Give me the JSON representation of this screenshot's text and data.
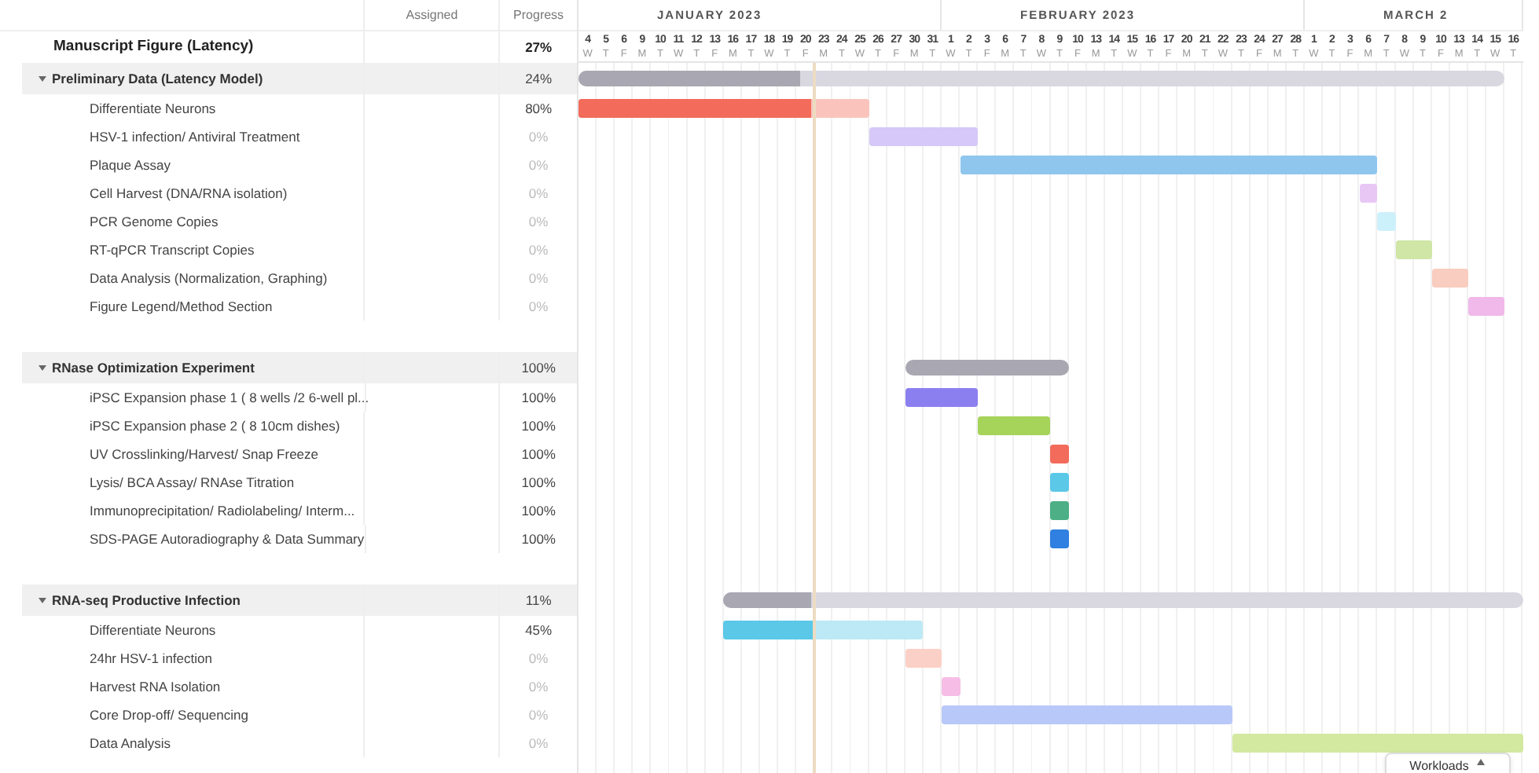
{
  "columns": {
    "assigned": "Assigned",
    "progress": "Progress"
  },
  "timeline": {
    "months": [
      {
        "label": "JANUARY 2023",
        "days": [
          {
            "num": "4",
            "dow": "W"
          },
          {
            "num": "5",
            "dow": "T"
          },
          {
            "num": "6",
            "dow": "F"
          },
          {
            "num": "9",
            "dow": "M"
          },
          {
            "num": "10",
            "dow": "T"
          },
          {
            "num": "11",
            "dow": "W"
          },
          {
            "num": "12",
            "dow": "T"
          },
          {
            "num": "13",
            "dow": "F"
          },
          {
            "num": "16",
            "dow": "M"
          },
          {
            "num": "17",
            "dow": "T"
          },
          {
            "num": "18",
            "dow": "W"
          },
          {
            "num": "19",
            "dow": "T"
          },
          {
            "num": "20",
            "dow": "F"
          },
          {
            "num": "23",
            "dow": "M"
          },
          {
            "num": "24",
            "dow": "T"
          },
          {
            "num": "25",
            "dow": "W"
          },
          {
            "num": "26",
            "dow": "T"
          },
          {
            "num": "27",
            "dow": "F"
          },
          {
            "num": "30",
            "dow": "M"
          },
          {
            "num": "31",
            "dow": "T"
          }
        ]
      },
      {
        "label": "FEBRUARY 2023",
        "days": [
          {
            "num": "1",
            "dow": "W"
          },
          {
            "num": "2",
            "dow": "T"
          },
          {
            "num": "3",
            "dow": "F"
          },
          {
            "num": "6",
            "dow": "M"
          },
          {
            "num": "7",
            "dow": "T"
          },
          {
            "num": "8",
            "dow": "W"
          },
          {
            "num": "9",
            "dow": "T"
          },
          {
            "num": "10",
            "dow": "F"
          },
          {
            "num": "13",
            "dow": "M"
          },
          {
            "num": "14",
            "dow": "T"
          },
          {
            "num": "15",
            "dow": "W"
          },
          {
            "num": "16",
            "dow": "T"
          },
          {
            "num": "17",
            "dow": "F"
          },
          {
            "num": "20",
            "dow": "M"
          },
          {
            "num": "21",
            "dow": "T"
          },
          {
            "num": "22",
            "dow": "W"
          },
          {
            "num": "23",
            "dow": "T"
          },
          {
            "num": "24",
            "dow": "F"
          },
          {
            "num": "27",
            "dow": "M"
          },
          {
            "num": "28",
            "dow": "T"
          }
        ]
      },
      {
        "label": "MARCH 2",
        "days": [
          {
            "num": "1",
            "dow": "W"
          },
          {
            "num": "2",
            "dow": "T"
          },
          {
            "num": "3",
            "dow": "F"
          },
          {
            "num": "6",
            "dow": "M"
          },
          {
            "num": "7",
            "dow": "T"
          },
          {
            "num": "8",
            "dow": "W"
          },
          {
            "num": "9",
            "dow": "T"
          },
          {
            "num": "10",
            "dow": "F"
          },
          {
            "num": "13",
            "dow": "M"
          },
          {
            "num": "14",
            "dow": "T"
          },
          {
            "num": "15",
            "dow": "W"
          },
          {
            "num": "16",
            "dow": "T"
          }
        ]
      }
    ]
  },
  "project": {
    "name": "Manuscript Figure (Latency)",
    "progress": "27%"
  },
  "groups": [
    {
      "name": "Preliminary Data (Latency Model)",
      "progress": "24%",
      "expanded": true,
      "bar": {
        "level": 0.24
      },
      "tasks": [
        {
          "name": "Differentiate Neurons",
          "progress": "80%",
          "bar": {
            "level": 0.8,
            "color": "#f26b5b"
          }
        },
        {
          "name": "HSV-1 infection/ Antiviral Treatment",
          "progress": "0%",
          "bar": {
            "color": "#d6c8f8"
          }
        },
        {
          "name": "Plaque Assay",
          "progress": "0%",
          "bar": {
            "color": "#8ec6ee"
          }
        },
        {
          "name": "Cell Harvest (DNA/RNA isolation)",
          "progress": "0%",
          "bar": {
            "color": "#e8c7f5"
          }
        },
        {
          "name": "PCR Genome Copies",
          "progress": "0%",
          "bar": {
            "color": "#cdf1fa"
          }
        },
        {
          "name": "RT-qPCR Transcript Copies",
          "progress": "0%",
          "bar": {
            "color": "#cfe6a6"
          }
        },
        {
          "name": "Data Analysis (Normalization, Graphing)",
          "progress": "0%",
          "bar": {
            "color": "#f9cdbf"
          }
        },
        {
          "name": "Figure Legend/Method Section",
          "progress": "0%",
          "bar": {
            "color": "#f1b8ea"
          }
        }
      ]
    },
    {
      "name": "RNase Optimization Experiment",
      "progress": "100%",
      "expanded": true,
      "bar": {
        "complete": true
      },
      "tasks": [
        {
          "name": "iPSC Expansion phase 1 ( 8 wells /2 6-well pl...",
          "progress": "100%",
          "bar": {
            "color": "#8b7ff0"
          }
        },
        {
          "name": "iPSC Expansion phase 2 ( 8 10cm dishes)",
          "progress": "100%",
          "bar": {
            "color": "#a6d35a"
          }
        },
        {
          "name": "UV Crosslinking/Harvest/ Snap Freeze",
          "progress": "100%",
          "bar": {
            "color": "#f26b5b"
          }
        },
        {
          "name": "Lysis/ BCA Assay/ RNAse Titration",
          "progress": "100%",
          "bar": {
            "color": "#5bc8e8"
          }
        },
        {
          "name": "Immunoprecipitation/ Radiolabeling/ Interm...",
          "progress": "100%",
          "bar": {
            "color": "#4caf85"
          }
        },
        {
          "name": "SDS-PAGE Autoradiography & Data Summary",
          "progress": "100%",
          "bar": {
            "color": "#2f80e0"
          }
        }
      ]
    },
    {
      "name": "RNA-seq Productive Infection",
      "progress": "11%",
      "expanded": true,
      "bar": {
        "level": 0.11
      },
      "tasks": [
        {
          "name": "Differentiate Neurons",
          "progress": "45%",
          "bar": {
            "level": 0.45,
            "color": "#5bc8e8"
          }
        },
        {
          "name": "24hr HSV-1 infection",
          "progress": "0%",
          "bar": {
            "color": "#fbd0c6"
          }
        },
        {
          "name": "Harvest RNA Isolation",
          "progress": "0%",
          "bar": {
            "color": "#f6bde6"
          }
        },
        {
          "name": "Core Drop-off/ Sequencing",
          "progress": "0%",
          "bar": {
            "color": "#b8c8f8"
          }
        },
        {
          "name": "Data Analysis",
          "progress": "0%",
          "bar": {
            "color": "#d3e9a0"
          }
        }
      ]
    }
  ],
  "workloads_button": {
    "label": "Workloads"
  }
}
